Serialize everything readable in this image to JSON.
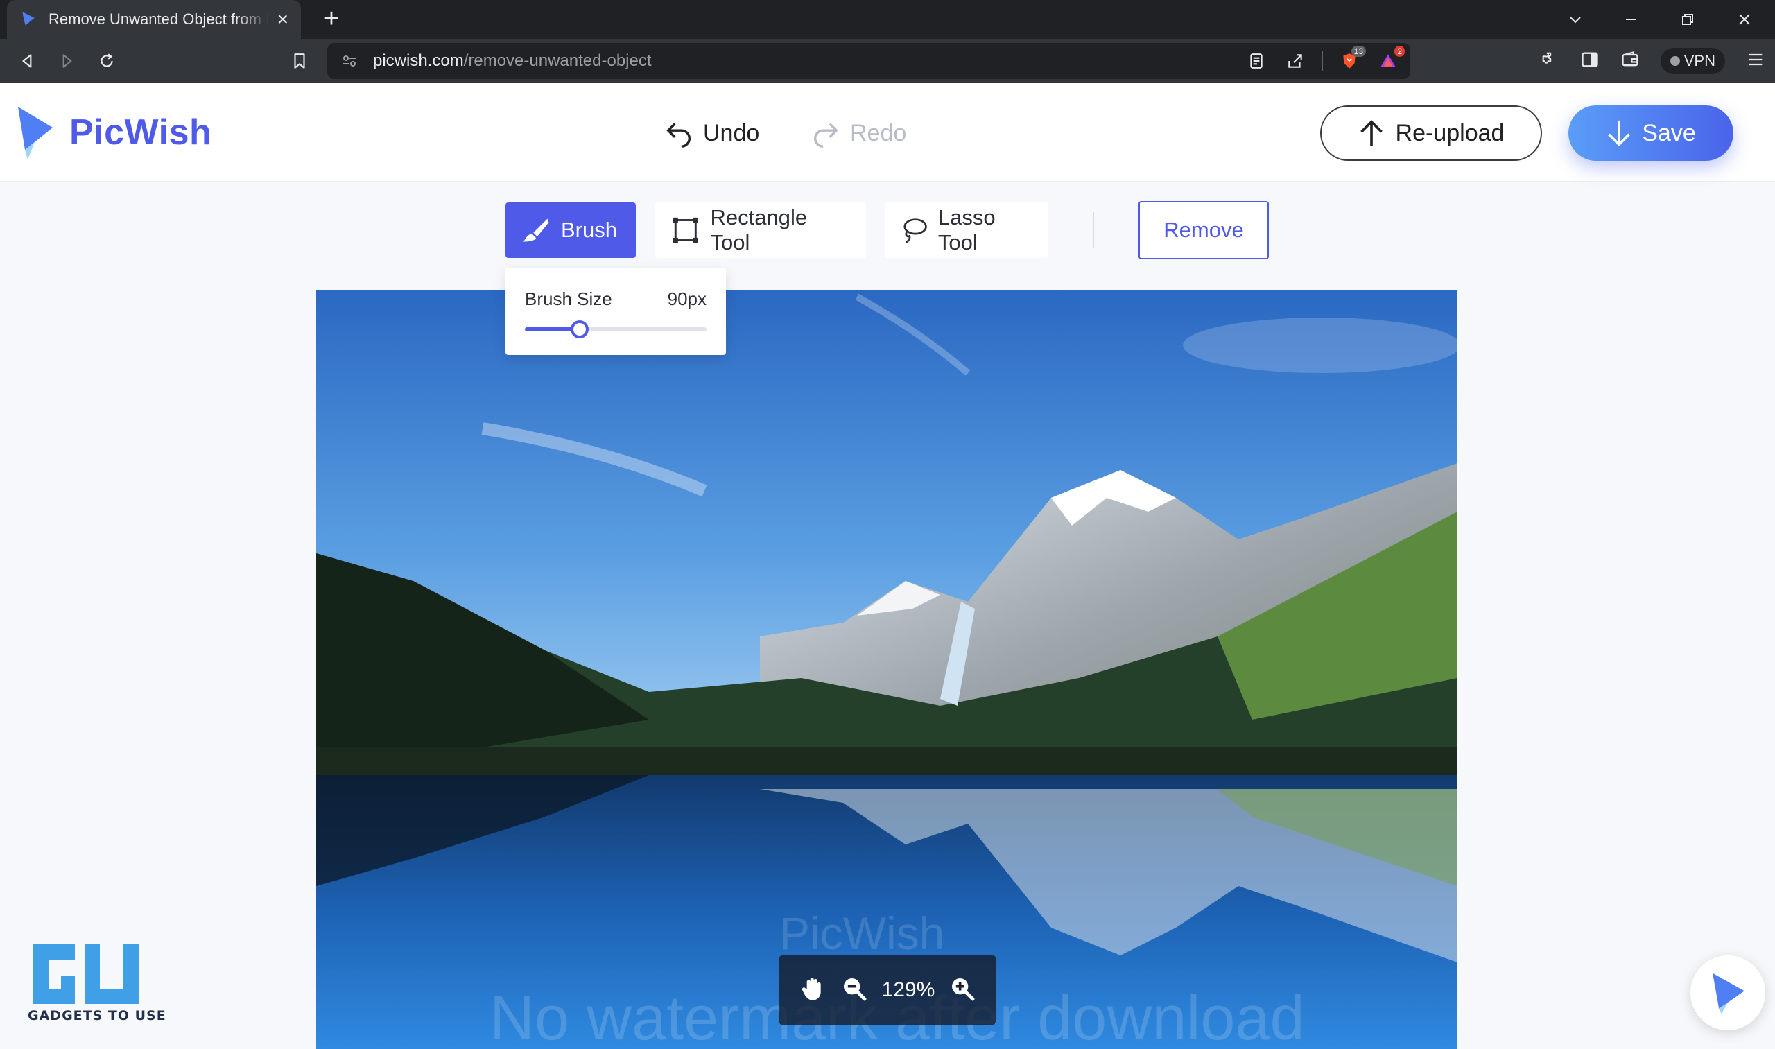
{
  "browser": {
    "tab_title": "Remove Unwanted Object from P",
    "url_host": "picwish.com",
    "url_path": "/remove-unwanted-object",
    "shield_badge": "13",
    "rewards_badge": "2",
    "vpn_label": "VPN"
  },
  "header": {
    "brand": "PicWish",
    "undo_label": "Undo",
    "redo_label": "Redo",
    "reupload_label": "Re-upload",
    "save_label": "Save"
  },
  "tools": {
    "brush_label": "Brush",
    "rectangle_label": "Rectangle Tool",
    "lasso_label": "Lasso Tool",
    "remove_label": "Remove",
    "active": "brush"
  },
  "brush_popup": {
    "label": "Brush Size",
    "value_text": "90px",
    "level": 0.3
  },
  "canvas": {
    "watermark_brand": "PicWish",
    "watermark_note": "No watermark after download"
  },
  "zoom": {
    "value": "129%"
  },
  "overlay": {
    "site_watermark": "GADGETS TO USE"
  },
  "colors": {
    "accent": "#4f5be8",
    "save_gradient_start": "#5a9df8",
    "save_gradient_end": "#4a63ea"
  }
}
